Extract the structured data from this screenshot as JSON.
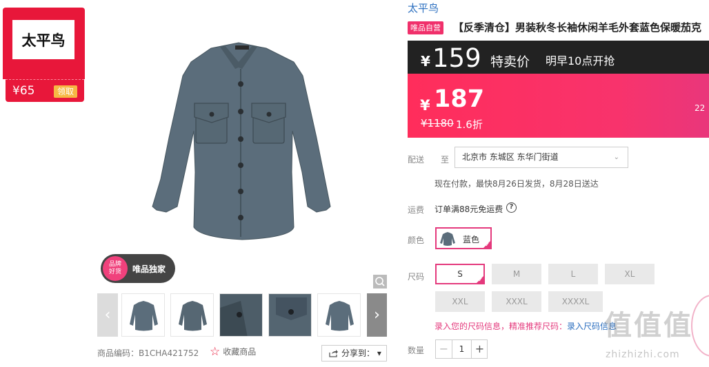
{
  "coupon": {
    "brand": "太平鸟",
    "amount": "¥65",
    "claim_label": "领取"
  },
  "gallery": {
    "badge_circle": "品牌\n好货",
    "badge_text": "唯品独家",
    "prev_arrow": "‹",
    "next_arrow": "›"
  },
  "footer": {
    "product_code": "商品编码：B1CHA421752",
    "favorite_label": "收藏商品",
    "share_label": "分享到：",
    "share_arrow": "▾"
  },
  "product": {
    "brand": "太平鸟",
    "self_operated_badge": "唯品自营",
    "title": "【反季清仓】男装秋冬长袖休闲羊毛外套蓝色保暖茄克"
  },
  "flash_sale": {
    "yen": "¥",
    "price": "159",
    "label": "特卖价",
    "open_time": "明早10点开抢"
  },
  "price": {
    "yen": "¥",
    "value": "187",
    "original": "¥1180",
    "discount": "1.6折",
    "side_text": "22"
  },
  "delivery": {
    "label": "配送",
    "to": "至",
    "address": "北京市 东城区 东华门街道",
    "address_arrow": "⌄",
    "note": "现在付款，最快8月26日发货，8月28日送达"
  },
  "freight": {
    "label": "运费",
    "text": "订单满88元免运费",
    "help": "?"
  },
  "color": {
    "label": "颜色",
    "options": [
      {
        "name": "蓝色",
        "selected": true
      }
    ]
  },
  "size": {
    "label": "尺码",
    "options": [
      {
        "name": "S",
        "selected": true
      },
      {
        "name": "M",
        "selected": false
      },
      {
        "name": "L",
        "selected": false
      },
      {
        "name": "XL",
        "selected": false
      },
      {
        "name": "XXL",
        "selected": false
      },
      {
        "name": "XXXL",
        "selected": false
      },
      {
        "name": "XXXXL",
        "selected": false
      }
    ],
    "hint": "录入您的尺码信息，精准推荐尺码：",
    "hint_link": "录入尺码信息"
  },
  "quantity": {
    "label": "数量",
    "value": "1",
    "minus": "−",
    "plus": "+"
  },
  "watermark": {
    "glyphs": "值值值",
    "url": "zhizhizhi.com"
  },
  "colors": {
    "accent": "#e8173a",
    "pink": "#f0306b",
    "select_border": "#e4397c",
    "link": "#2a6ebf"
  }
}
